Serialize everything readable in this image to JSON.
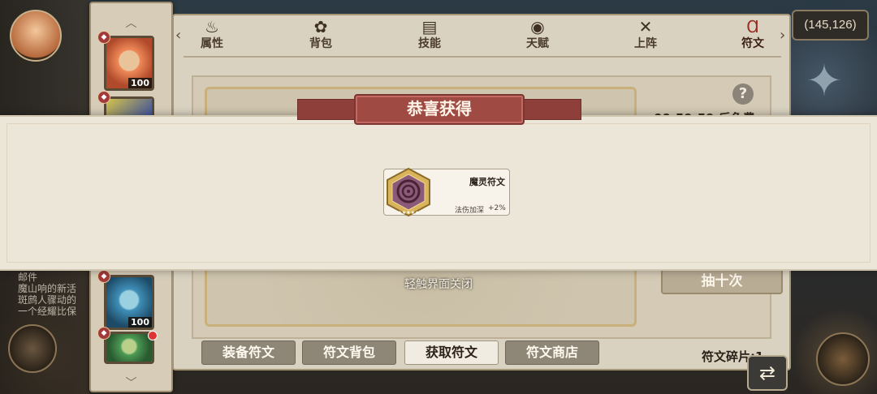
{
  "hud": {
    "coords": "(145,126)",
    "left_text": "邮件\n魔山响的新活\n斑鹧人骤动的\n一个经耀比保",
    "compass_icon": "compass-rose"
  },
  "heroes": [
    {
      "level": "100",
      "portrait_colors": [
        "#f08a5a",
        "#e9c39a"
      ]
    },
    {
      "level": "",
      "portrait_colors": [
        "#d4c24a",
        "#3a4fa0"
      ]
    },
    {
      "level": "100",
      "portrait_colors": [
        "#3f8fb8",
        "#9bd0e0"
      ]
    },
    {
      "level": "",
      "portrait_colors": [
        "#4c9a55",
        "#b8d08a"
      ]
    }
  ],
  "tabs": [
    {
      "label": "属性",
      "icon": "flame-icon",
      "glyph": "♨"
    },
    {
      "label": "背包",
      "icon": "backpack-icon",
      "glyph": "✿"
    },
    {
      "label": "技能",
      "icon": "book-icon",
      "glyph": "▤"
    },
    {
      "label": "天赋",
      "icon": "eye-icon",
      "glyph": "◉"
    },
    {
      "label": "上阵",
      "icon": "crossed-swords-icon",
      "glyph": "✕"
    },
    {
      "label": "符文",
      "icon": "rune-icon",
      "glyph": "Ɑ",
      "active": true
    }
  ],
  "rune_page": {
    "timer": "00:59:59 后免费",
    "draw_ten": "抽十次",
    "bottom_tabs": [
      {
        "label": "装备符文"
      },
      {
        "label": "符文背包"
      },
      {
        "label": "获取符文",
        "active": true
      },
      {
        "label": "符文商店"
      }
    ],
    "fragments": "符文碎片:1"
  },
  "reward": {
    "title": "恭喜获得",
    "item_name": "魔灵符文",
    "stat_label": "法伤加深",
    "stat_value": "+2%",
    "close_hint": "轻触界面关闭",
    "rune_colors": {
      "frame": "#d9b45a",
      "core": "#8a5a78",
      "swirl": "#4a2236"
    }
  },
  "colors": {
    "panel": "#d9d2c1",
    "ribbon": "#a04a44",
    "tab_active": "#9b2c24"
  }
}
